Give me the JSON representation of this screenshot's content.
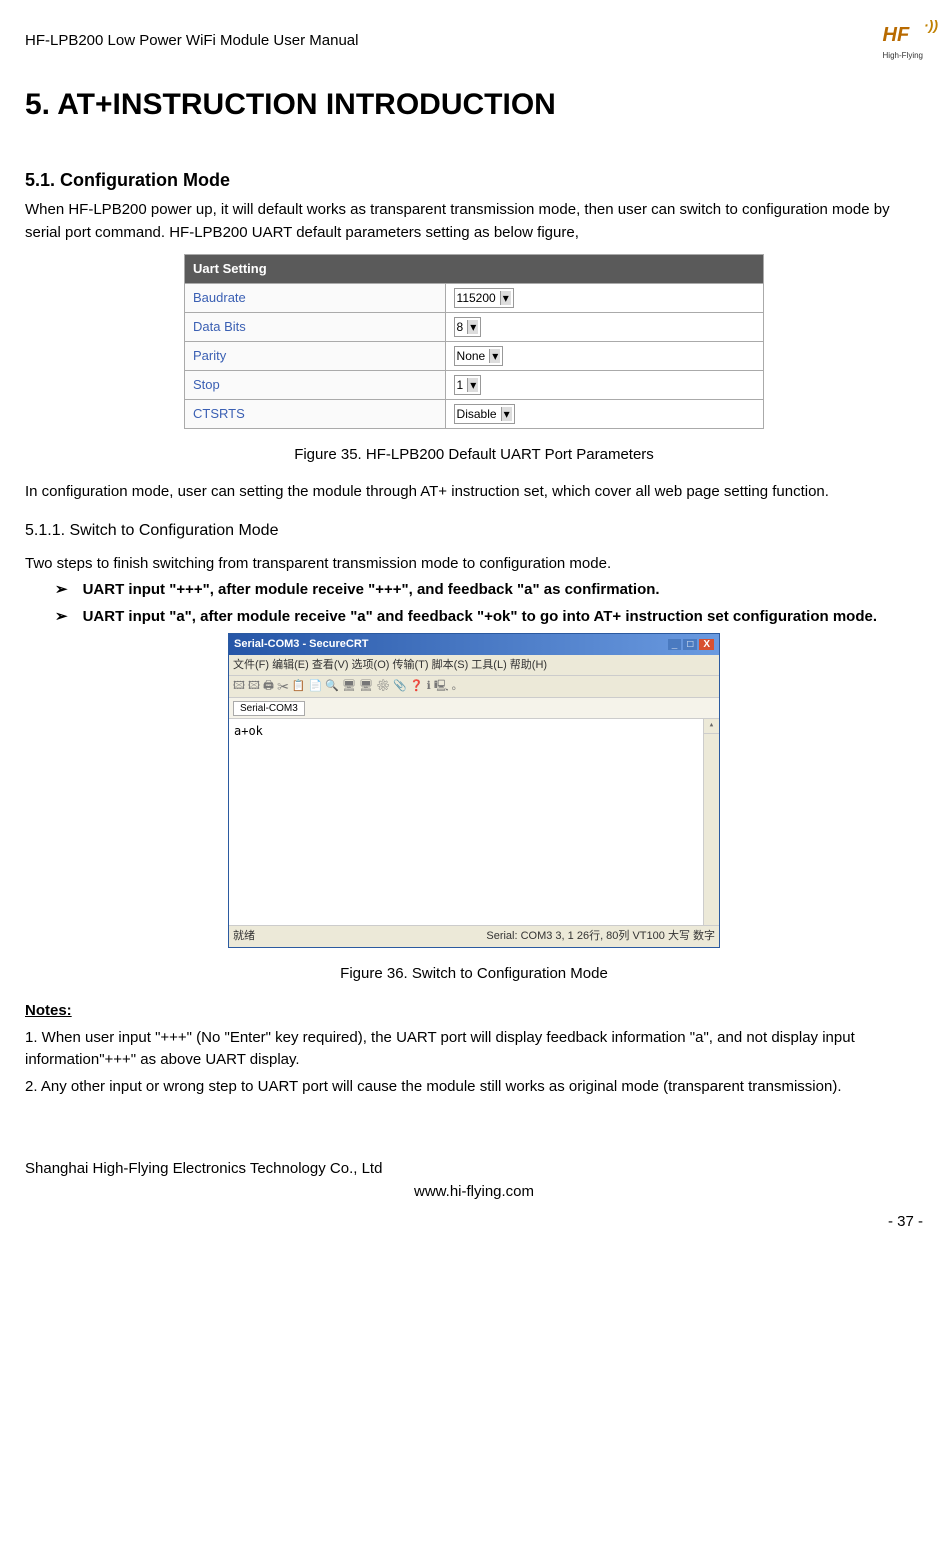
{
  "header": {
    "doc_title": "HF-LPB200 Low Power WiFi Module User Manual",
    "logo_main": "HF",
    "logo_sub": "High-Flying"
  },
  "section_title": "5. AT+INSTRUCTION INTRODUCTION",
  "s51": {
    "heading": "5.1.  Configuration Mode",
    "p1": "When HF-LPB200 power up, it will default works as transparent transmission mode, then user can switch to configuration mode by serial port command. HF-LPB200 UART default parameters setting as below figure,"
  },
  "uart": {
    "title": "Uart Setting",
    "rows": {
      "baudrate_label": "Baudrate",
      "baudrate_value": "115200",
      "databits_label": "Data Bits",
      "databits_value": "8",
      "parity_label": "Parity",
      "parity_value": "None",
      "stop_label": "Stop",
      "stop_value": "1",
      "ctsrts_label": "CTSRTS",
      "ctsrts_value": "Disable"
    }
  },
  "fig35": "Figure 35.   HF-LPB200 Default UART Port Parameters",
  "para_after_fig35": "In configuration mode, user can setting the module through AT+ instruction set, which cover all web page setting function.",
  "s511": {
    "heading": "5.1.1.   Switch to Configuration Mode",
    "p1": "Two steps to finish switching from transparent transmission mode to configuration mode."
  },
  "bullets": {
    "mark": "➢",
    "b1": "UART input \"+++\", after module receive \"+++\", and feedback \"a\" as confirmation.",
    "b2": "UART input \"a\", after module receive \"a\" and feedback \"+ok\" to go into AT+ instruction set configuration mode."
  },
  "crt": {
    "title": "Serial-COM3 - SecureCRT",
    "menu": "文件(F)  编辑(E)  查看(V)  选项(O)  传输(T)  脚本(S)  工具(L)  帮助(H)",
    "toolbar": "🖾 🖾 🖨 ✂  📋 📄  🔍 🖥 🖥 ⚙ 📎 ❓  ℹ  🖳 。",
    "tab": "Serial-COM3",
    "body": "a+ok",
    "status_left": "就绪",
    "status_right": "Serial: COM3   3,    1   26行, 80列 VT100     大写 数字"
  },
  "fig36": "Figure 36.   Switch to Configuration Mode",
  "notes": {
    "heading": "Notes:",
    "n1": "1. When user input \"+++\" (No \"Enter\" key required), the UART port will display feedback information \"a\", and not display input information\"+++\" as above UART display.",
    "n2": "2. Any other input or wrong step to UART port will cause the module still works as original mode (transparent transmission)."
  },
  "footer": {
    "company": "Shanghai High-Flying Electronics Technology Co., Ltd",
    "url": "www.hi-flying.com",
    "page": "- 37 -"
  }
}
